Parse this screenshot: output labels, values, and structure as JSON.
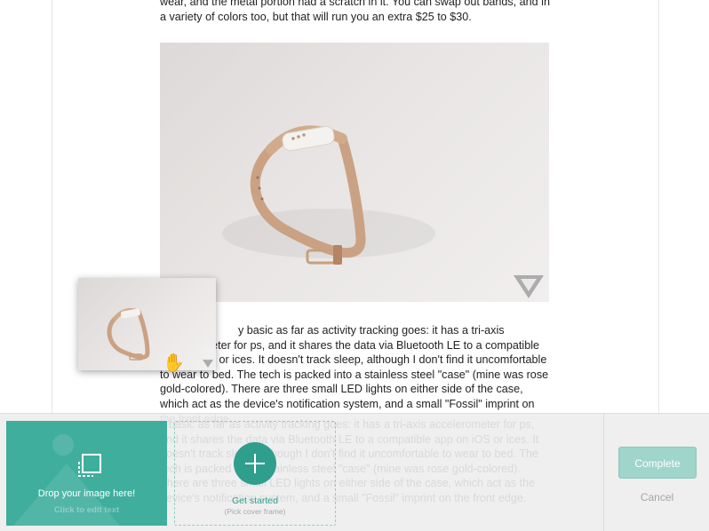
{
  "article": {
    "paragraph_top": "wear, and the metal portion had a scratch in it. You can swap out bands, and in a variety of colors too, but that will run you an extra $25 to $30.",
    "paragraph_body": "y basic as far as activity tracking goes: it has a tri-axis accelerometer for ps, and it shares the data via Bluetooth LE to a compatible app on iOS or ices. It doesn't track sleep, although I don't find it uncomfortable to wear to bed. The tech is packed into a stainless steel \"case\" (mine was rose gold-colored). There are three small LED lights on either side of the case, which act as the device's notification system, and a small \"Fossil\" imprint on the front edge.",
    "photo_alt": "Fossil fitness band with tan leather strap on white background",
    "watermark_icon": "verge-triangle-icon"
  },
  "dragging_thumbnail": {
    "alt": "Thumbnail of the band photo being dragged",
    "cursor_icon": "grab-hand-icon"
  },
  "cover_editor": {
    "drop_zone": {
      "icon": "image-frame-icon",
      "label": "Drop your image here!",
      "hint": "Click to edit text"
    },
    "get_started": {
      "icon": "plus-icon",
      "label": "Get started",
      "sublabel": "(Pick cover frame)"
    },
    "complete_label": "Complete",
    "cancel_label": "Cancel"
  },
  "colors": {
    "accent": "#2f9e8d",
    "drop_zone_bg": "#3fae9d",
    "complete_button": "#9fd5cb"
  }
}
